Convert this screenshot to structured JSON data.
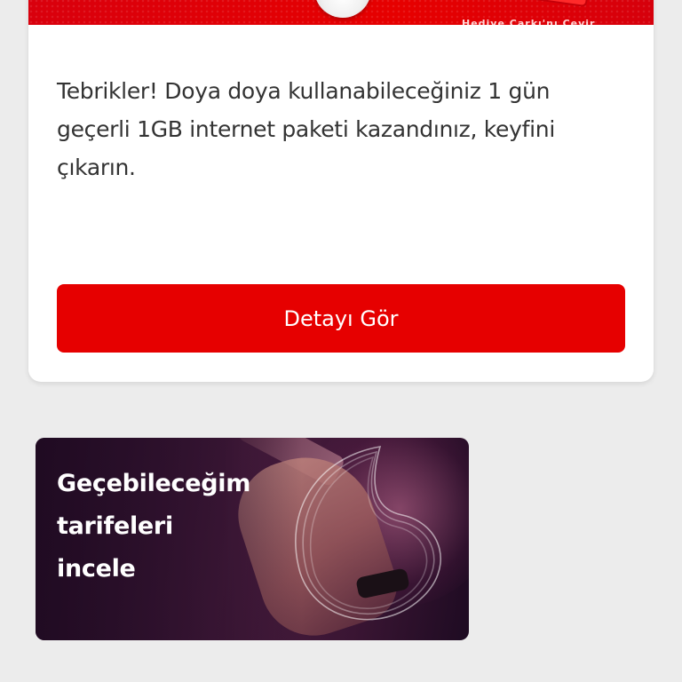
{
  "reward_card": {
    "banner": {
      "caption": "Hediye Çarkı'nı Çevir",
      "brand_color": "#e60000"
    },
    "message": "Tebrikler! Doya doya kullanabileceğiniz 1 gün geçerli 1GB internet paketi kazandınız, keyfini çıkarın.",
    "button_label": "Detayı Gör",
    "button_color": "#e60000"
  },
  "promo_card": {
    "title_lines": [
      "Geçebileceğim",
      "tarifeleri",
      "incele"
    ],
    "icon": "vodafone-speechmark-icon"
  }
}
